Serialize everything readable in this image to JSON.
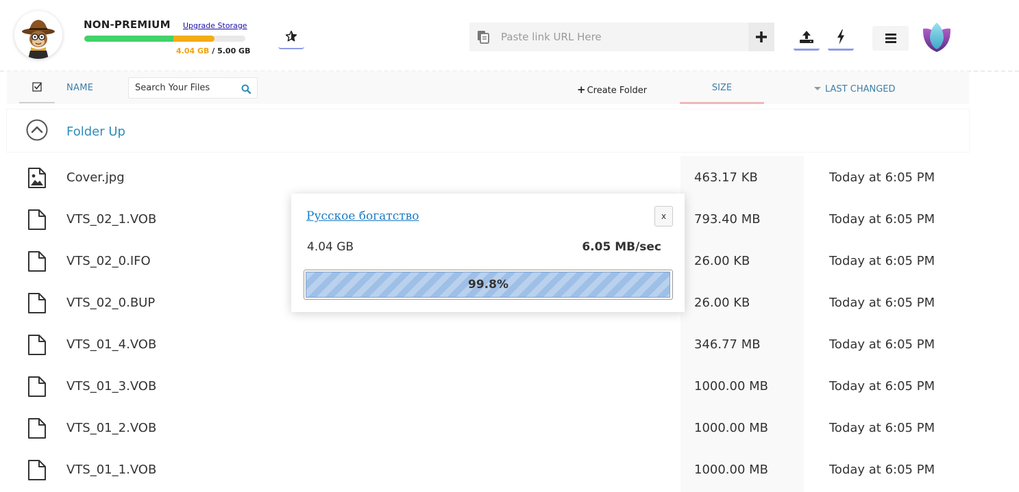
{
  "header": {
    "plan_name": "NON-PREMIUM",
    "upgrade_label": "Upgrade Storage",
    "storage_used": "4.04 GB",
    "storage_separator": " / ",
    "storage_total": "5.00 GB",
    "storage_fraction": 0.808,
    "url_placeholder": "Paste link URL Here",
    "icons": {
      "avatar": "explorer-monkey-avatar",
      "favorites": "star-icon",
      "clipboard": "clipboard-icon",
      "add": "plus-icon",
      "upload": "upload-icon",
      "lightning": "lightning-icon",
      "menu": "hamburger-menu-icon",
      "logo": "lotus-logo"
    },
    "colors": {
      "accent": "#8d9be6",
      "storage_green": "#42d26a",
      "storage_orange": "#f2ad14"
    }
  },
  "toolbar": {
    "name_label": "NAME",
    "search_placeholder": "Search Your Files",
    "create_folder_label": "Create Folder",
    "size_label": "SIZE",
    "last_changed_label": "LAST CHANGED"
  },
  "folder_up": {
    "label": "Folder Up"
  },
  "files": [
    {
      "name": "Cover.jpg",
      "size": "463.17 KB",
      "changed": "Today at 6:05 PM",
      "icon": "image-file-icon"
    },
    {
      "name": "VTS_02_1.VOB",
      "size": "793.40 MB",
      "changed": "Today at 6:05 PM",
      "icon": "file-icon"
    },
    {
      "name": "VTS_02_0.IFO",
      "size": "26.00 KB",
      "changed": "Today at 6:05 PM",
      "icon": "file-icon"
    },
    {
      "name": "VTS_02_0.BUP",
      "size": "26.00 KB",
      "changed": "Today at 6:05 PM",
      "icon": "file-icon"
    },
    {
      "name": "VTS_01_4.VOB",
      "size": "346.77 MB",
      "changed": "Today at 6:05 PM",
      "icon": "file-icon"
    },
    {
      "name": "VTS_01_3.VOB",
      "size": "1000.00 MB",
      "changed": "Today at 6:05 PM",
      "icon": "file-icon"
    },
    {
      "name": "VTS_01_2.VOB",
      "size": "1000.00 MB",
      "changed": "Today at 6:05 PM",
      "icon": "file-icon"
    },
    {
      "name": "VTS_01_1.VOB",
      "size": "1000.00 MB",
      "changed": "Today at 6:05 PM",
      "icon": "file-icon"
    }
  ],
  "download_modal": {
    "title": "Русское богатство",
    "close_label": "x",
    "size": "4.04 GB",
    "speed": "6.05 MB/sec",
    "progress_label": "99.8%",
    "progress_fraction": 0.998,
    "colors": {
      "progress": "#9ebfe6",
      "title_link": "#1a7bc6"
    }
  }
}
